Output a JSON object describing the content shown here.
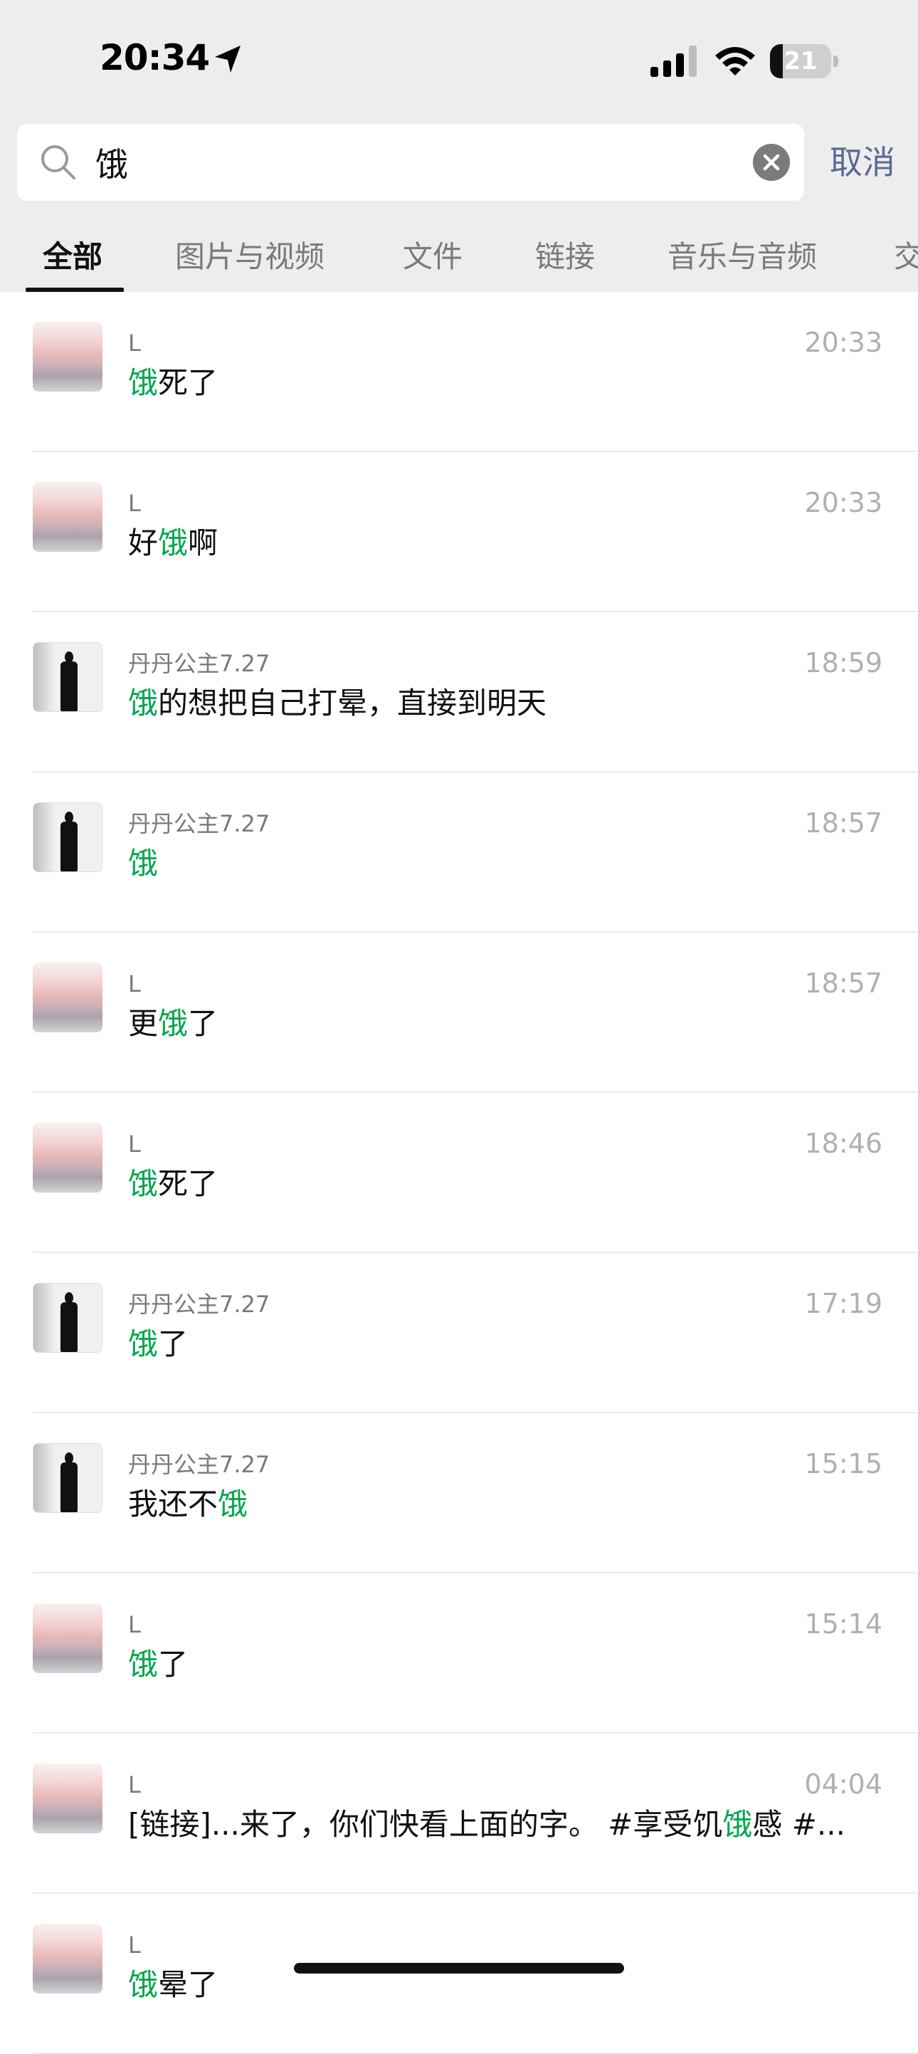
{
  "status_bar": {
    "time": "20:34",
    "battery_level": 21,
    "icons": [
      "location-arrow-icon",
      "cellular-signal-icon",
      "wifi-icon",
      "battery-icon"
    ]
  },
  "search": {
    "query": "饿",
    "cancel_label": "取消"
  },
  "tabs": [
    {
      "label": "全部",
      "active": true
    },
    {
      "label": "图片与视频",
      "active": false
    },
    {
      "label": "文件",
      "active": false
    },
    {
      "label": "链接",
      "active": false
    },
    {
      "label": "音乐与音频",
      "active": false
    },
    {
      "label": "交",
      "active": false
    }
  ],
  "colors": {
    "highlight": "#07a651",
    "link_blue": "#576b95",
    "header_bg": "#ededed"
  },
  "results": [
    {
      "avatar": "pink-sky-avatar",
      "sender": "L",
      "time": "20:33",
      "parts": [
        {
          "t": "饿",
          "h": true
        },
        {
          "t": "死了",
          "h": false
        }
      ]
    },
    {
      "avatar": "pink-sky-avatar",
      "sender": "L",
      "time": "20:33",
      "parts": [
        {
          "t": "好",
          "h": false
        },
        {
          "t": "饿",
          "h": true
        },
        {
          "t": "啊",
          "h": false
        }
      ]
    },
    {
      "avatar": "bw-figure-avatar",
      "sender": "丹丹公主7.27",
      "time": "18:59",
      "parts": [
        {
          "t": "饿",
          "h": true
        },
        {
          "t": "的想把自己打晕，直接到明天",
          "h": false
        }
      ]
    },
    {
      "avatar": "bw-figure-avatar",
      "sender": "丹丹公主7.27",
      "time": "18:57",
      "parts": [
        {
          "t": "饿",
          "h": true
        }
      ]
    },
    {
      "avatar": "pink-sky-avatar",
      "sender": "L",
      "time": "18:57",
      "parts": [
        {
          "t": "更",
          "h": false
        },
        {
          "t": "饿",
          "h": true
        },
        {
          "t": "了",
          "h": false
        }
      ]
    },
    {
      "avatar": "pink-sky-avatar",
      "sender": "L",
      "time": "18:46",
      "parts": [
        {
          "t": "饿",
          "h": true
        },
        {
          "t": "死了",
          "h": false
        }
      ]
    },
    {
      "avatar": "bw-figure-avatar",
      "sender": "丹丹公主7.27",
      "time": "17:19",
      "parts": [
        {
          "t": "饿",
          "h": true
        },
        {
          "t": "了",
          "h": false
        }
      ]
    },
    {
      "avatar": "bw-figure-avatar",
      "sender": "丹丹公主7.27",
      "time": "15:15",
      "parts": [
        {
          "t": "我还不",
          "h": false
        },
        {
          "t": "饿",
          "h": true
        }
      ]
    },
    {
      "avatar": "pink-sky-avatar",
      "sender": "L",
      "time": "15:14",
      "parts": [
        {
          "t": "饿",
          "h": true
        },
        {
          "t": "了",
          "h": false
        }
      ]
    },
    {
      "avatar": "pink-sky-avatar",
      "sender": "L",
      "time": "04:04",
      "parts": [
        {
          "t": "[链接]...来了，你们快看上面的字。 #享受饥",
          "h": false
        },
        {
          "t": "饿",
          "h": true
        },
        {
          "t": "感  #...",
          "h": false
        }
      ]
    },
    {
      "avatar": "pink-sky-avatar",
      "sender": "L",
      "time": "",
      "parts": [
        {
          "t": "饿",
          "h": true
        },
        {
          "t": "晕了",
          "h": false
        }
      ]
    }
  ]
}
